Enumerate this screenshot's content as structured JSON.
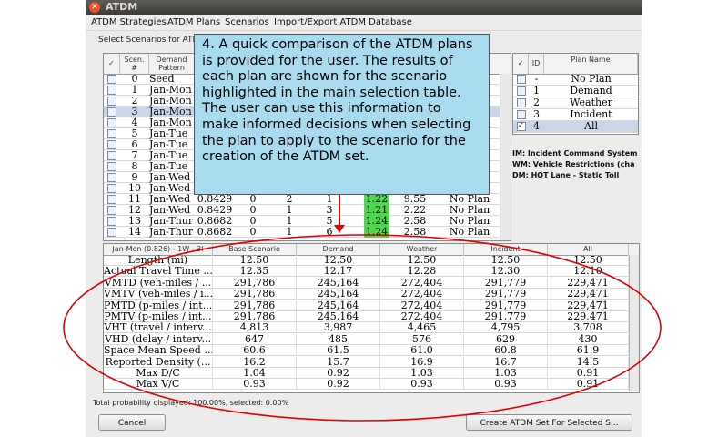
{
  "window": {
    "title": "ATDM"
  },
  "menu": [
    "ATDM Strategies",
    "ATDM Plans",
    "Scenarios",
    "Import/Export ATDM Database"
  ],
  "group_label": "Select Scenarios for ATDM Set",
  "scenario_table": {
    "headers": [
      "✓",
      "Scen. #",
      "Demand Pattern"
    ],
    "rows": [
      {
        "num": "0",
        "pattern": "Seed",
        "selected": false
      },
      {
        "num": "1",
        "pattern": "Jan-Mon",
        "selected": false
      },
      {
        "num": "2",
        "pattern": "Jan-Mon",
        "selected": false
      },
      {
        "num": "3",
        "pattern": "Jan-Mon",
        "selected": true
      },
      {
        "num": "4",
        "pattern": "Jan-Mon",
        "selected": false
      },
      {
        "num": "5",
        "pattern": "Jan-Tue",
        "selected": false
      },
      {
        "num": "6",
        "pattern": "Jan-Tue",
        "selected": false
      },
      {
        "num": "7",
        "pattern": "Jan-Tue",
        "selected": false
      },
      {
        "num": "8",
        "pattern": "Jan-Tue",
        "selected": false
      },
      {
        "num": "9",
        "pattern": "Jan-Wed",
        "selected": false
      },
      {
        "num": "10",
        "pattern": "Jan-Wed",
        "selected": false
      }
    ],
    "full_rows": [
      {
        "num": "11",
        "pattern": "Jan-Wed",
        "prob": "0.8429",
        "c1": "0",
        "c2": "2",
        "c3": "1",
        "dc": "1.22",
        "tt": "9.55",
        "plan": "No Plan"
      },
      {
        "num": "12",
        "pattern": "Jan-Wed",
        "prob": "0.8429",
        "c1": "0",
        "c2": "1",
        "c3": "3",
        "dc": "1.21",
        "tt": "2.22",
        "plan": "No Plan"
      },
      {
        "num": "13",
        "pattern": "Jan-Thur",
        "prob": "0.8682",
        "c1": "0",
        "c2": "1",
        "c3": "5",
        "dc": "1.24",
        "tt": "2.58",
        "plan": "No Plan"
      },
      {
        "num": "14",
        "pattern": "Jan-Thur",
        "prob": "0.8682",
        "c1": "0",
        "c2": "1",
        "c3": "6",
        "dc": "1.24",
        "tt": "2.58",
        "plan": "No Plan"
      }
    ]
  },
  "plan_table": {
    "headers": [
      "✓",
      "ID",
      "Plan Name"
    ],
    "rows": [
      {
        "id": "-",
        "name": "No Plan",
        "checked": false
      },
      {
        "id": "1",
        "name": "Demand",
        "checked": false
      },
      {
        "id": "2",
        "name": "Weather",
        "checked": false
      },
      {
        "id": "3",
        "name": "Incident",
        "checked": false
      },
      {
        "id": "4",
        "name": "All",
        "checked": true
      }
    ]
  },
  "plan_info": [
    "IM: Incident Command System",
    "WM: Vehicle Restrictions (cha",
    "DM: HOT Lane - Static Toll"
  ],
  "callout": "4. A quick comparison of the ATDM plans is provided for the user.  The results of each plan are shown for the scenario highlighted in the main selection table.  The user can use this information to make informed decisions when selecting the plan to apply to the scenario for the creation of the ATDM set.",
  "comparison_table": {
    "headers": [
      "Jan-Mon (0.826) - 1W - 3I",
      "Base Scenario",
      "Demand",
      "Weather",
      "Incident",
      "All"
    ],
    "rows": [
      {
        "label": "Length (mi)",
        "vals": [
          "12.50",
          "12.50",
          "12.50",
          "12.50",
          "12.50"
        ]
      },
      {
        "label": "Actual Travel Time ...",
        "vals": [
          "12.35",
          "12.17",
          "12.28",
          "12.30",
          "12.10"
        ]
      },
      {
        "label": "VMTD (veh-miles / ...",
        "vals": [
          "291,786",
          "245,164",
          "272,404",
          "291,779",
          "229,471"
        ]
      },
      {
        "label": "VMTV (veh-miles / i...",
        "vals": [
          "291,786",
          "245,164",
          "272,404",
          "291,779",
          "229,471"
        ]
      },
      {
        "label": "PMTD (p-miles / int...",
        "vals": [
          "291,786",
          "245,164",
          "272,404",
          "291,779",
          "229,471"
        ]
      },
      {
        "label": "PMTV (p-miles / int...",
        "vals": [
          "291,786",
          "245,164",
          "272,404",
          "291,779",
          "229,471"
        ]
      },
      {
        "label": "VHT (travel / interv...",
        "vals": [
          "4,813",
          "3,987",
          "4,465",
          "4,795",
          "3,708"
        ]
      },
      {
        "label": "VHD (delay / interv...",
        "vals": [
          "647",
          "485",
          "576",
          "629",
          "430"
        ]
      },
      {
        "label": "Space Mean Speed ...",
        "vals": [
          "60.6",
          "61.5",
          "61.0",
          "60.8",
          "61.9"
        ]
      },
      {
        "label": "Reported Density (...",
        "vals": [
          "16.2",
          "15.7",
          "16.9",
          "16.7",
          "14.5"
        ]
      },
      {
        "label": "Max D/C",
        "vals": [
          "1.04",
          "0.92",
          "1.03",
          "1.03",
          "0.91"
        ]
      },
      {
        "label": "Max V/C",
        "vals": [
          "0.93",
          "0.92",
          "0.93",
          "0.93",
          "0.91"
        ]
      }
    ]
  },
  "status": "Total probability displayed: 100.00%, selected: 0.00%",
  "buttons": {
    "cancel": "Cancel",
    "create": "Create ATDM Set For Selected S..."
  },
  "colors": {
    "callout_bg": "#a9dbf0",
    "highlight_green": "#4cd74c",
    "annotation_red": "#e00000",
    "selected_row": "#c9d6e8"
  }
}
